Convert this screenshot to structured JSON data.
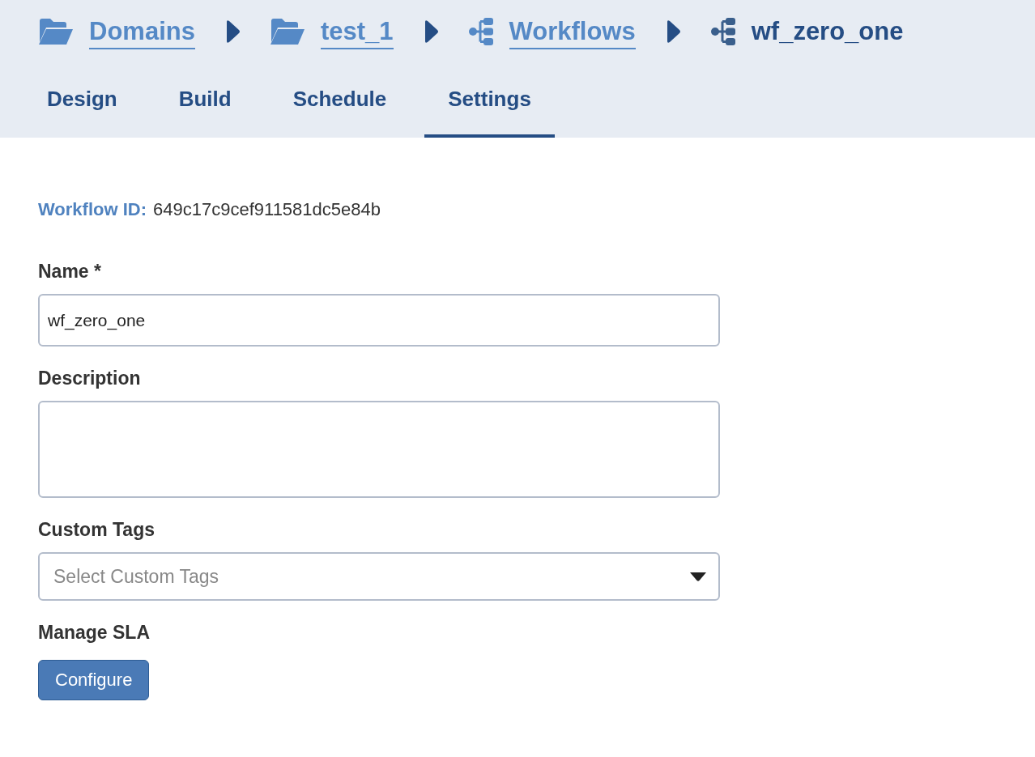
{
  "breadcrumb": [
    {
      "label": "Domains",
      "kind": "folder",
      "link": true
    },
    {
      "label": "test_1",
      "kind": "folder",
      "link": true
    },
    {
      "label": "Workflows",
      "kind": "workflow",
      "link": true
    },
    {
      "label": "wf_zero_one",
      "kind": "workflow",
      "link": false
    }
  ],
  "tabs": [
    {
      "label": "Design",
      "selected": false
    },
    {
      "label": "Build",
      "selected": false
    },
    {
      "label": "Schedule",
      "selected": false
    },
    {
      "label": "Settings",
      "selected": true
    }
  ],
  "workflow_id": {
    "label": "Workflow ID:",
    "value": "649c17c9cef911581dc5e84b"
  },
  "form": {
    "name": {
      "label": "Name *",
      "value": "wf_zero_one"
    },
    "description": {
      "label": "Description"
    },
    "custom_tags": {
      "label": "Custom Tags",
      "placeholder": "Select Custom Tags"
    },
    "manage_sla": {
      "label": "Manage SLA",
      "button": "Configure"
    }
  }
}
